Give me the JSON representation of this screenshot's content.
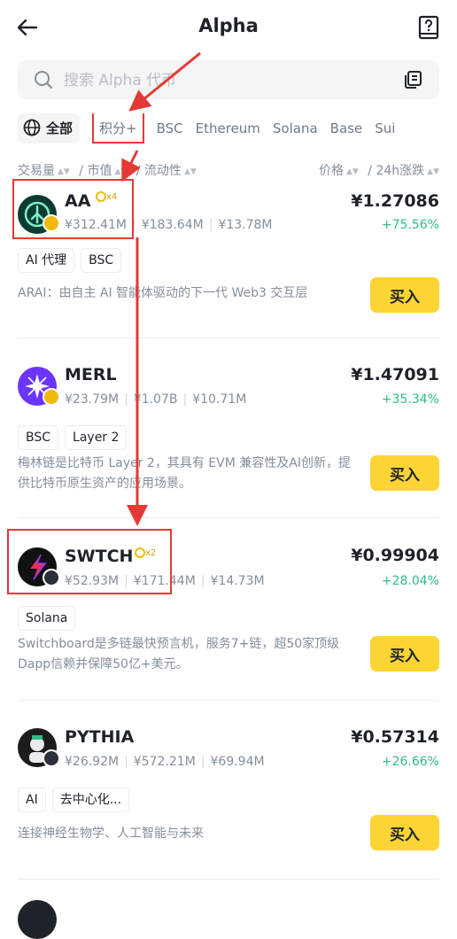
{
  "header": {
    "title": "Alpha",
    "back_icon": "arrow-left-icon",
    "guide_icon": "book-question-icon"
  },
  "search": {
    "placeholder": "搜索 Alpha 代币",
    "icon": "search-icon",
    "action_icon": "copy-icon"
  },
  "tabs": [
    {
      "label": "全部",
      "icon": "globe-icon",
      "active": true
    },
    {
      "label": "积分+"
    },
    {
      "label": "BSC"
    },
    {
      "label": "Ethereum"
    },
    {
      "label": "Solana"
    },
    {
      "label": "Base"
    },
    {
      "label": "Sui"
    }
  ],
  "sort": {
    "volume": "交易量",
    "market_cap": "/ 市值",
    "liquidity": "/ 流动性",
    "price": "价格",
    "change": "/ 24h涨跌"
  },
  "colors": {
    "accent": "#fcd535",
    "up": "#2ebd85",
    "annotation": "#e53935"
  },
  "tokens": [
    {
      "symbol": "AA",
      "multiplier": "x4",
      "volume": "¥312.41M",
      "market_cap": "¥183.64M",
      "liquidity": "¥13.78M",
      "price": "¥1.27086",
      "change": "+75.56%",
      "tags": [
        "AI 代理",
        "BSC"
      ],
      "description": "ARAI：由自主 AI 智能体驱动的下一代 Web3 交互层",
      "buy": "买入"
    },
    {
      "symbol": "MERL",
      "multiplier": "",
      "volume": "¥23.79M",
      "market_cap": "¥1.07B",
      "liquidity": "¥10.71M",
      "price": "¥1.47091",
      "change": "+35.34%",
      "tags": [
        "BSC",
        "Layer 2"
      ],
      "description": "梅林链是比特币 Layer 2，其具有 EVM 兼容性及AI创新，提供比特币原生资产的应用场景。",
      "buy": "买入"
    },
    {
      "symbol": "SWTCH",
      "multiplier": "x2",
      "volume": "¥52.93M",
      "market_cap": "¥171.44M",
      "liquidity": "¥14.73M",
      "price": "¥0.99904",
      "change": "+28.04%",
      "tags": [
        "Solana"
      ],
      "description": "Switchboard是多链最快预言机，服务7+链，超50家顶级Dapp信赖并保障50亿+美元。",
      "buy": "买入"
    },
    {
      "symbol": "PYTHIA",
      "multiplier": "",
      "volume": "¥26.92M",
      "market_cap": "¥572.21M",
      "liquidity": "¥69.94M",
      "price": "¥0.57314",
      "change": "+26.66%",
      "tags": [
        "AI",
        "去中心化..."
      ],
      "description": "连接神经生物学、人工智能与未来",
      "buy": "买入"
    }
  ]
}
